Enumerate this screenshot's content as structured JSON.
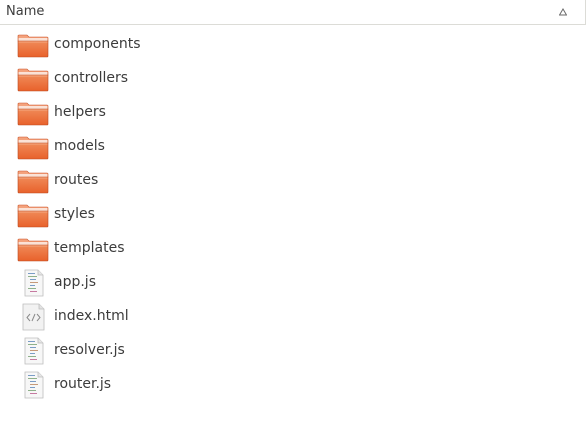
{
  "header": {
    "column_label": "Name",
    "sort_icon": "sort-ascending-arrow-icon"
  },
  "colors": {
    "folder_top": "#f4a27c",
    "folder_body": "#e8612b",
    "text": "#3c3c3c",
    "border": "#dcdcd7"
  },
  "items": [
    {
      "name": "components",
      "type": "folder",
      "icon": "folder-icon"
    },
    {
      "name": "controllers",
      "type": "folder",
      "icon": "folder-icon"
    },
    {
      "name": "helpers",
      "type": "folder",
      "icon": "folder-icon"
    },
    {
      "name": "models",
      "type": "folder",
      "icon": "folder-icon"
    },
    {
      "name": "routes",
      "type": "folder",
      "icon": "folder-icon"
    },
    {
      "name": "styles",
      "type": "folder",
      "icon": "folder-icon"
    },
    {
      "name": "templates",
      "type": "folder",
      "icon": "folder-icon"
    },
    {
      "name": "app.js",
      "type": "file-js",
      "icon": "javascript-file-icon"
    },
    {
      "name": "index.html",
      "type": "file-html",
      "icon": "html-file-icon"
    },
    {
      "name": "resolver.js",
      "type": "file-js",
      "icon": "javascript-file-icon"
    },
    {
      "name": "router.js",
      "type": "file-js",
      "icon": "javascript-file-icon"
    }
  ]
}
